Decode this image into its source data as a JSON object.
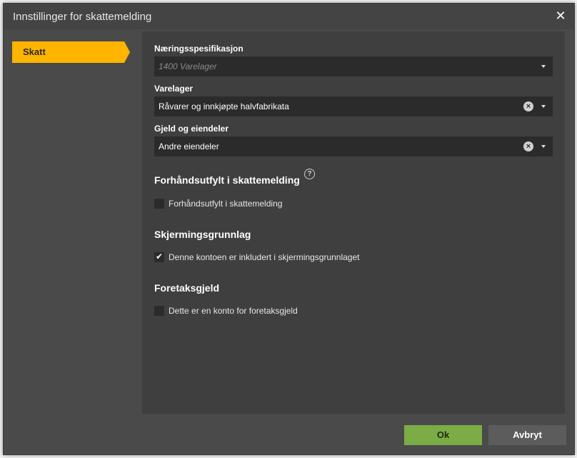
{
  "dialog": {
    "title": "Innstillinger for skattemelding",
    "close_symbol": "✕"
  },
  "tabs": [
    {
      "label": "Skatt",
      "active": true
    }
  ],
  "fields": {
    "naeringsspesifikasjon": {
      "label": "Næringsspesifikasjon",
      "placeholder": "1400 Varelager",
      "value": ""
    },
    "varelager": {
      "label": "Varelager",
      "value": "Råvarer og innkjøpte halvfabrikata"
    },
    "gjeld": {
      "label": "Gjeld og eiendeler",
      "value": "Andre eiendeler"
    }
  },
  "sections": {
    "forhandsutfylt": {
      "title": "Forhåndsutfylt i skattemelding",
      "help_symbol": "?",
      "checkbox_label": "Forhåndsutfylt i skattemelding",
      "checked": false
    },
    "skjerming": {
      "title": "Skjermingsgrunnlag",
      "checkbox_label": "Denne kontoen er inkludert i skjermingsgrunnlaget",
      "checked": true,
      "check_symbol": "✔"
    },
    "foretaksgjeld": {
      "title": "Foretaksgjeld",
      "checkbox_label": "Dette er en konto for foretaksgjeld",
      "checked": false
    }
  },
  "buttons": {
    "ok": "Ok",
    "cancel": "Avbryt"
  },
  "colors": {
    "accent": "#ffb400",
    "ok_button": "#7cac45",
    "background": "#4a4a4a"
  },
  "icons": {
    "clear": "×"
  }
}
